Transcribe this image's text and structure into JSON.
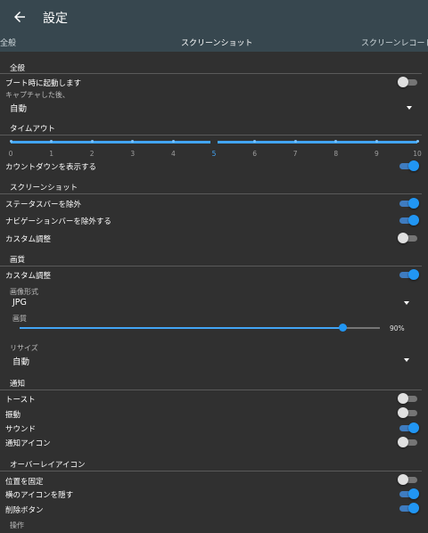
{
  "appbar": {
    "title": "設定",
    "back_icon": "arrow-left-icon"
  },
  "tabs": [
    {
      "label": "全般",
      "active": false
    },
    {
      "label": "スクリーンショット",
      "active": true
    },
    {
      "label": "スクリーンレコード",
      "active": false
    }
  ],
  "general": {
    "header": "全般",
    "boot_start": {
      "label": "ブート時に起動します",
      "on": false
    },
    "after_capture": {
      "label": "キャプチャした後、",
      "value": "自動"
    }
  },
  "timeout": {
    "header": "タイムアウト",
    "ticks": [
      "0",
      "1",
      "2",
      "3",
      "4",
      "5",
      "6",
      "7",
      "8",
      "9",
      "10"
    ],
    "selected": 5,
    "countdown": {
      "label": "カウントダウンを表示する",
      "on": true
    }
  },
  "screenshot": {
    "header": "スクリーンショット",
    "exclude_status": {
      "label": "ステータスバーを除外",
      "on": true
    },
    "exclude_nav": {
      "label": "ナビゲーションバーを除外する",
      "on": true
    },
    "custom": {
      "label": "カスタム調整",
      "on": false
    }
  },
  "quality": {
    "header": "画質",
    "custom": {
      "label": "カスタム調整",
      "on": true
    },
    "format": {
      "label": "画像形式",
      "value": "JPG"
    },
    "quality": {
      "label": "画質",
      "value_text": "90%",
      "fraction": 0.9
    },
    "resize": {
      "label": "リサイズ",
      "value": "自動"
    }
  },
  "notify": {
    "header": "通知",
    "toast": {
      "label": "トースト",
      "on": false
    },
    "vibrate": {
      "label": "振動",
      "on": false
    },
    "sound": {
      "label": "サウンド",
      "on": true
    },
    "icon": {
      "label": "通知アイコン",
      "on": false
    }
  },
  "overlay": {
    "header": "オーバーレイアイコン",
    "fix_position": {
      "label": "位置を固定",
      "on": false
    },
    "hide_side": {
      "label": "横のアイコンを隠す",
      "on": true
    },
    "delete_button": {
      "label": "削除ボタン",
      "on": true
    },
    "operation": {
      "label": "操作"
    }
  },
  "colors": {
    "accent": "#2196f3",
    "appbar": "#37474f",
    "background": "#303030"
  }
}
